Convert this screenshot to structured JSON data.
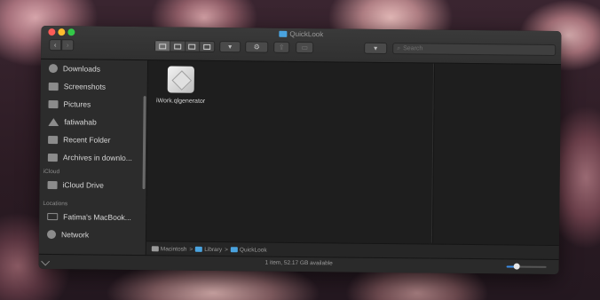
{
  "window": {
    "title": "QuickLook"
  },
  "toolbar": {
    "back_icon": "‹",
    "forward_icon": "›",
    "group_icon": "▾",
    "action_icon": "⚙",
    "search_placeholder": "Search"
  },
  "sidebar": {
    "favorites": [
      {
        "label": "Downloads",
        "icon": "download-icon"
      },
      {
        "label": "Screenshots",
        "icon": "folder-icon"
      },
      {
        "label": "Pictures",
        "icon": "pictures-icon"
      },
      {
        "label": "fatiwahab",
        "icon": "home-icon"
      },
      {
        "label": "Recent Folder",
        "icon": "folder-icon"
      },
      {
        "label": "Archives in downlo...",
        "icon": "folder-icon"
      }
    ],
    "icloud_header": "iCloud",
    "icloud_items": [
      {
        "label": "iCloud Drive",
        "icon": "folder-icon"
      }
    ],
    "locations_header": "Locations",
    "location_items": [
      {
        "label": "Fatima's MacBook...",
        "icon": "laptop-icon"
      },
      {
        "label": "Network",
        "icon": "globe-icon"
      }
    ]
  },
  "files": [
    {
      "name": "iWork.qlgenerator",
      "icon": "qlgenerator-icon"
    }
  ],
  "pathbar": {
    "items": [
      "Macintosh",
      "Library",
      "QuickLook"
    ],
    "separator": ">"
  },
  "status": {
    "text": "1 item, 52.17 GB available",
    "icon_size_fraction": 0.25
  },
  "colors": {
    "accent": "#3a8de8",
    "folder": "#4aa3df"
  }
}
